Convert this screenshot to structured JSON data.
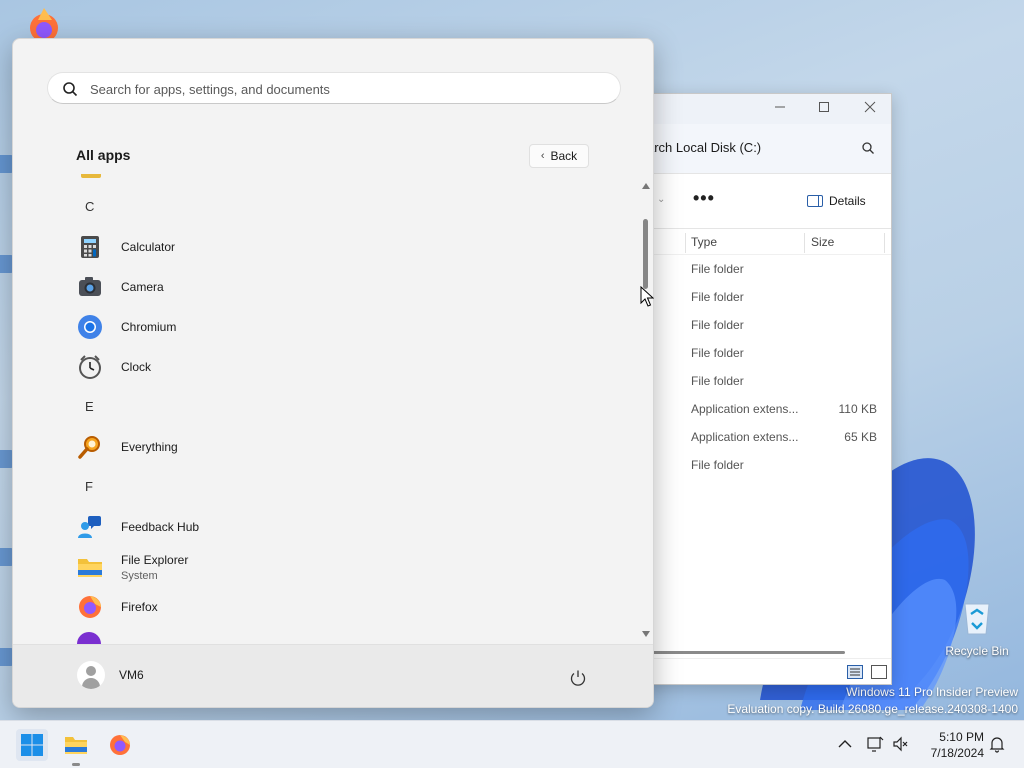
{
  "desktop": {
    "recycle_bin_label": "Recycle Bin",
    "watermark_line1": "Windows 11 Pro Insider Preview",
    "watermark_line2": "Evaluation copy. Build 26080.ge_release.240308-1400"
  },
  "explorer": {
    "search_text": "arch Local Disk (C:)",
    "details_label": "Details",
    "more_label": "•••",
    "columns": [
      "Type",
      "Size"
    ],
    "rows": [
      {
        "type": "File folder",
        "size": ""
      },
      {
        "type": "File folder",
        "size": ""
      },
      {
        "type": "File folder",
        "size": ""
      },
      {
        "type": "File folder",
        "size": ""
      },
      {
        "type": "File folder",
        "size": ""
      },
      {
        "type": "Application extens...",
        "size": "110 KB"
      },
      {
        "type": "Application extens...",
        "size": "65 KB"
      },
      {
        "type": "File folder",
        "size": ""
      }
    ]
  },
  "start": {
    "search_placeholder": "Search for apps, settings, and documents",
    "all_apps_title": "All apps",
    "back_label": "Back",
    "letters": [
      "C",
      "E",
      "F"
    ],
    "apps": [
      {
        "name": "Calculator",
        "sub": "",
        "icon": "calculator-icon"
      },
      {
        "name": "Camera",
        "sub": "",
        "icon": "camera-icon"
      },
      {
        "name": "Chromium",
        "sub": "",
        "icon": "chromium-icon"
      },
      {
        "name": "Clock",
        "sub": "",
        "icon": "clock-icon"
      },
      {
        "name": "Everything",
        "sub": "",
        "icon": "everything-icon"
      },
      {
        "name": "Feedback Hub",
        "sub": "",
        "icon": "feedback-hub-icon"
      },
      {
        "name": "File Explorer",
        "sub": "System",
        "icon": "folder-icon"
      },
      {
        "name": "Firefox",
        "sub": "",
        "icon": "firefox-icon"
      }
    ],
    "user_name": "VM6"
  },
  "taskbar": {
    "time": "5:10 PM",
    "date": "7/18/2024"
  },
  "colors": {
    "accent": "#0067c0",
    "start_bg": "#f3f3f3",
    "taskbar_bg": "#eef1f6"
  }
}
